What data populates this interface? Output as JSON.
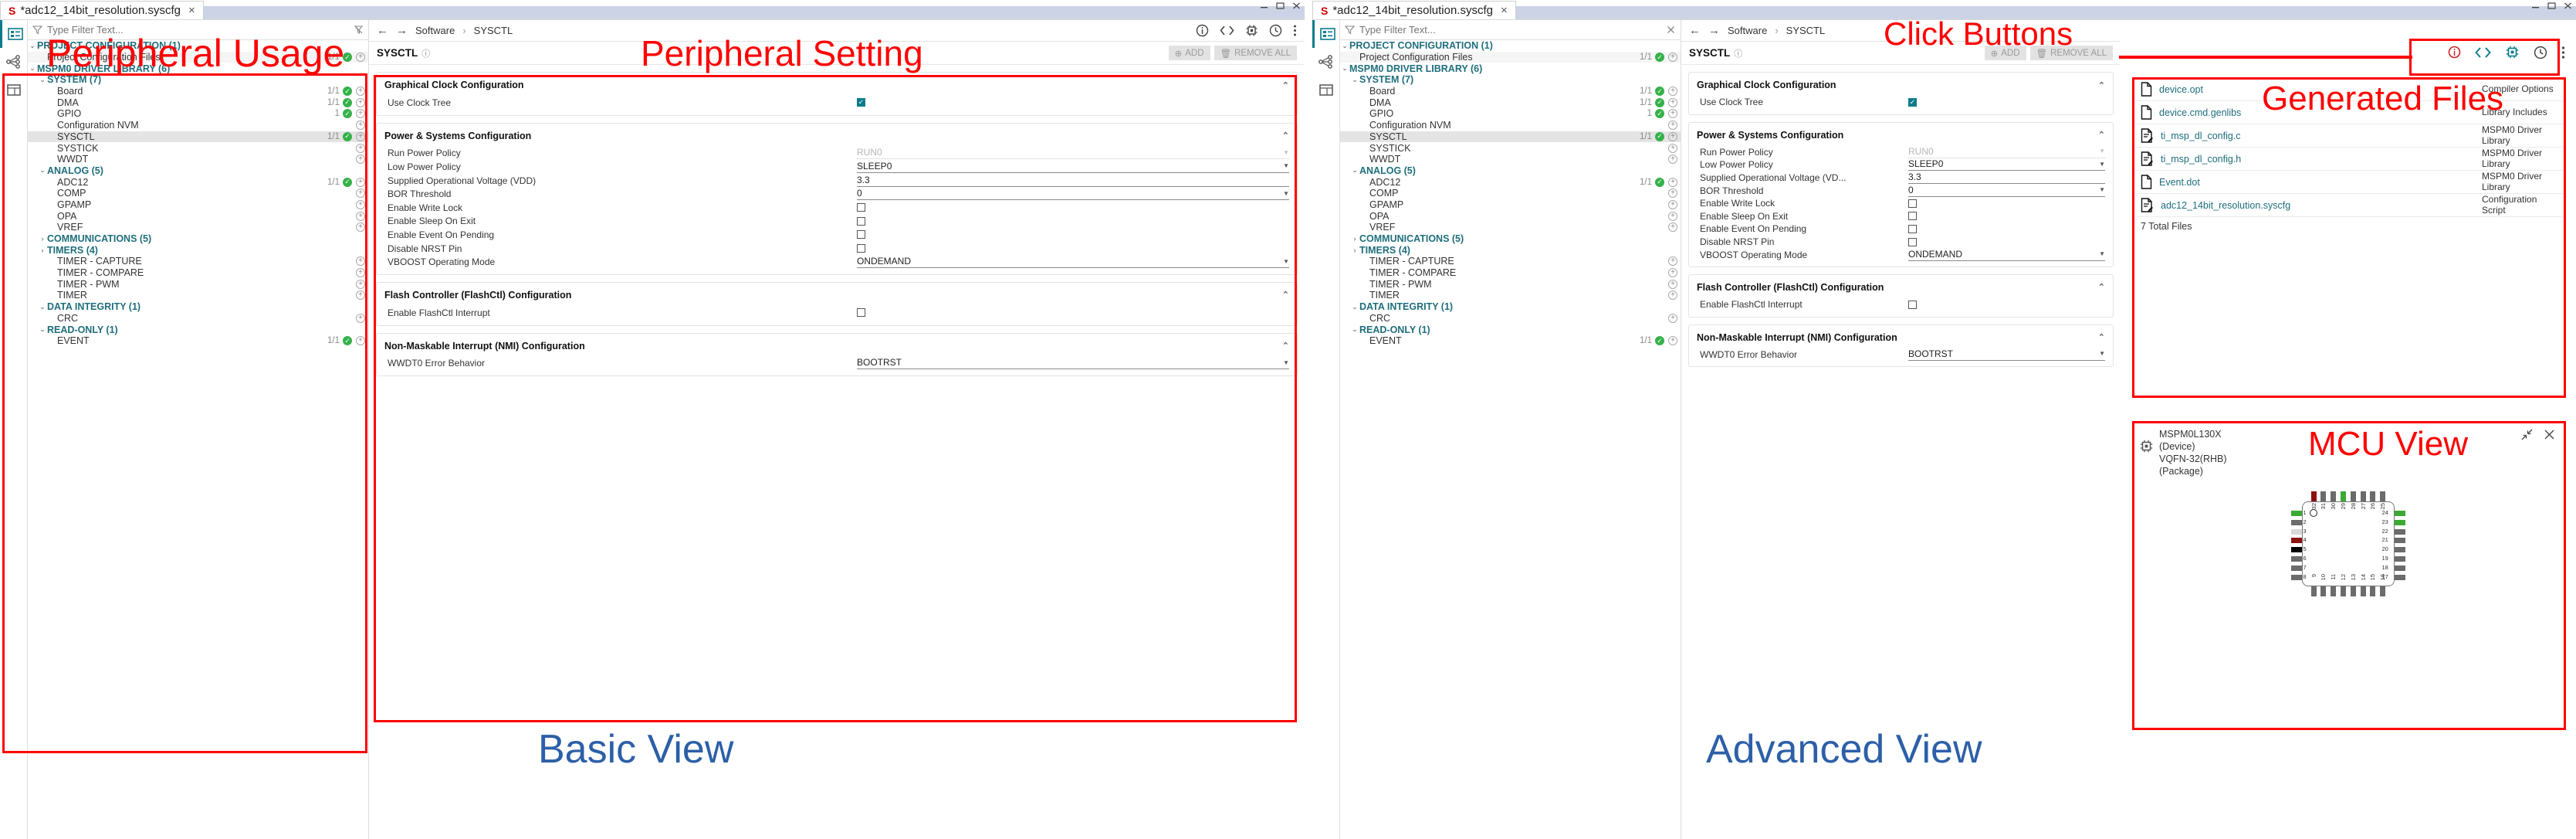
{
  "window_left": {
    "tab": {
      "label": "*adc12_14bit_resolution.syscfg",
      "icon": "syscfg-icon",
      "close": "×"
    },
    "filter": {
      "placeholder": "Type Filter Text...",
      "icon": "filter-icon",
      "clear": "clear-icon"
    },
    "rail": [
      "blocks-icon",
      "network-icon",
      "table-icon"
    ],
    "tree": [
      {
        "label": "PROJECT CONFIGURATION (1)",
        "type": "group",
        "indent": 0,
        "chevron": "⌄",
        "count": "",
        "ok": false,
        "plus": false
      },
      {
        "label": "Project Configuration Files",
        "type": "leaf",
        "indent": 1,
        "count": "1/1",
        "ok": true,
        "plus": true,
        "alt": true
      },
      {
        "label": "MSPM0 DRIVER LIBRARY (6)",
        "type": "group",
        "indent": 0,
        "chevron": "⌄",
        "count": "",
        "ok": false,
        "plus": false
      },
      {
        "label": "SYSTEM (7)",
        "type": "group",
        "indent": 1,
        "chevron": "⌄",
        "count": "",
        "ok": false,
        "plus": false
      },
      {
        "label": "Board",
        "type": "leaf",
        "indent": 2,
        "count": "1/1",
        "ok": true,
        "plus": true
      },
      {
        "label": "DMA",
        "type": "leaf",
        "indent": 2,
        "count": "1/1",
        "ok": true,
        "plus": true
      },
      {
        "label": "GPIO",
        "type": "leaf",
        "indent": 2,
        "count": "1",
        "ok": true,
        "plus": true
      },
      {
        "label": "Configuration NVM",
        "type": "leaf",
        "indent": 2,
        "count": "",
        "ok": false,
        "plus": true
      },
      {
        "label": "SYSCTL",
        "type": "leaf",
        "indent": 2,
        "count": "1/1",
        "ok": true,
        "plus": true,
        "selected": true
      },
      {
        "label": "SYSTICK",
        "type": "leaf",
        "indent": 2,
        "count": "",
        "ok": false,
        "plus": true
      },
      {
        "label": "WWDT",
        "type": "leaf",
        "indent": 2,
        "count": "",
        "ok": false,
        "plus": true
      },
      {
        "label": "ANALOG (5)",
        "type": "group",
        "indent": 1,
        "chevron": "⌄",
        "count": "",
        "ok": false,
        "plus": false
      },
      {
        "label": "ADC12",
        "type": "leaf",
        "indent": 2,
        "count": "1/1",
        "ok": true,
        "plus": true
      },
      {
        "label": "COMP",
        "type": "leaf",
        "indent": 2,
        "count": "",
        "ok": false,
        "plus": true
      },
      {
        "label": "GPAMP",
        "type": "leaf",
        "indent": 2,
        "count": "",
        "ok": false,
        "plus": true
      },
      {
        "label": "OPA",
        "type": "leaf",
        "indent": 2,
        "count": "",
        "ok": false,
        "plus": true
      },
      {
        "label": "VREF",
        "type": "leaf",
        "indent": 2,
        "count": "",
        "ok": false,
        "plus": true
      },
      {
        "label": "COMMUNICATIONS (5)",
        "type": "group",
        "indent": 1,
        "chevron": "›",
        "count": "",
        "ok": false,
        "plus": false
      },
      {
        "label": "TIMERS (4)",
        "type": "group",
        "indent": 1,
        "chevron": "›",
        "count": "",
        "ok": false,
        "plus": false
      },
      {
        "label": "TIMER - CAPTURE",
        "type": "leaf",
        "indent": 2,
        "count": "",
        "ok": false,
        "plus": true
      },
      {
        "label": "TIMER - COMPARE",
        "type": "leaf",
        "indent": 2,
        "count": "",
        "ok": false,
        "plus": true
      },
      {
        "label": "TIMER - PWM",
        "type": "leaf",
        "indent": 2,
        "count": "",
        "ok": false,
        "plus": true
      },
      {
        "label": "TIMER",
        "type": "leaf",
        "indent": 2,
        "count": "",
        "ok": false,
        "plus": true
      },
      {
        "label": "DATA INTEGRITY (1)",
        "type": "group",
        "indent": 1,
        "chevron": "⌄",
        "count": "",
        "ok": false,
        "plus": false
      },
      {
        "label": "CRC",
        "type": "leaf",
        "indent": 2,
        "count": "",
        "ok": false,
        "plus": true
      },
      {
        "label": "READ-ONLY (1)",
        "type": "group",
        "indent": 1,
        "chevron": "⌄",
        "count": "",
        "ok": false,
        "plus": false
      },
      {
        "label": "EVENT",
        "type": "leaf",
        "indent": 2,
        "count": "1/1",
        "ok": true,
        "plus": true
      }
    ],
    "breadcrumb": {
      "back": "←",
      "forward": "→",
      "root": "Software",
      "sep": "›",
      "leaf": "SYSCTL",
      "icons": [
        "info-icon",
        "code-icon",
        "chip-icon",
        "history-icon",
        "more-icon"
      ]
    },
    "module": {
      "name": "SYSCTL",
      "help": "?",
      "add": "ADD",
      "remove": "REMOVE ALL"
    }
  },
  "settings": {
    "sections": [
      {
        "title": "Graphical Clock Configuration",
        "collapse": "⌃",
        "fields": [
          {
            "label": "Use Clock Tree",
            "kind": "checkbox",
            "value": true
          }
        ]
      },
      {
        "title": "Power & Systems Configuration",
        "collapse": "⌃",
        "fields": [
          {
            "label": "Run Power Policy",
            "kind": "select",
            "value": "RUN0",
            "disabled": true
          },
          {
            "label": "Low Power Policy",
            "kind": "select",
            "value": "SLEEP0"
          },
          {
            "label": "Supplied Operational Voltage (VDD)",
            "label_short": "Supplied Operational Voltage (VD...",
            "kind": "text",
            "value": "3.3"
          },
          {
            "label": "BOR Threshold",
            "kind": "select",
            "value": "0"
          },
          {
            "label": "Enable Write Lock",
            "kind": "checkbox",
            "value": false
          },
          {
            "label": "Enable Sleep On Exit",
            "kind": "checkbox",
            "value": false
          },
          {
            "label": "Enable Event On Pending",
            "kind": "checkbox",
            "value": false
          },
          {
            "label": "Disable NRST Pin",
            "kind": "checkbox",
            "value": false
          },
          {
            "label": "VBOOST Operating Mode",
            "kind": "select",
            "value": "ONDEMAND"
          }
        ]
      },
      {
        "title": "Flash Controller (FlashCtl) Configuration",
        "collapse": "⌃",
        "fields": [
          {
            "label": "Enable FlashCtl Interrupt",
            "kind": "checkbox",
            "value": false
          }
        ]
      },
      {
        "title": "Non-Maskable Interrupt (NMI) Configuration",
        "collapse": "⌃",
        "fields": [
          {
            "label": "WWDT0 Error Behavior",
            "kind": "select",
            "value": "BOOTRST"
          }
        ]
      }
    ]
  },
  "generated_files": {
    "rows": [
      {
        "name": "device.opt",
        "kind": "Compiler Options",
        "icon": "file-icon"
      },
      {
        "name": "device.cmd.genlibs",
        "kind": "Library Includes",
        "icon": "file-icon"
      },
      {
        "name": "ti_msp_dl_config.c",
        "kind": "MSPM0 Driver Library",
        "icon": "file-edit-icon"
      },
      {
        "name": "ti_msp_dl_config.h",
        "kind": "MSPM0 Driver Library",
        "icon": "file-edit-icon"
      },
      {
        "name": "Event.dot",
        "kind": "MSPM0 Driver Library",
        "icon": "file-icon"
      },
      {
        "name": "adc12_14bit_resolution.syscfg",
        "kind": "Configuration Script",
        "icon": "file-edit-icon"
      }
    ],
    "total": "7 Total Files"
  },
  "mcu_view": {
    "icon": "chip-icon",
    "device": "MSPM0L130X",
    "device_sub": "(Device)",
    "package": "VQFN-32(RHB)",
    "package_sub": "(Package)",
    "collapse_icon": "collapse-icon",
    "close_icon": "close-icon",
    "pins_left": [
      "1",
      "2",
      "3",
      "4",
      "5",
      "6",
      "7",
      "8"
    ],
    "pins_bottom": [
      "9",
      "10",
      "11",
      "12",
      "13",
      "14",
      "15",
      "16"
    ],
    "pins_right": [
      "24",
      "23",
      "22",
      "21",
      "20",
      "19",
      "18",
      "17"
    ],
    "pins_top": [
      "32",
      "31",
      "30",
      "29",
      "28",
      "27",
      "26",
      "25"
    ],
    "pin_colors_left": [
      "#3aaa35",
      "#6b6b6b",
      "#d8d8d8",
      "#8d1111",
      "#000000",
      "#6b6b6b",
      "#6b6b6b",
      "#6b6b6b"
    ],
    "pin_colors_right": [
      "#3aaa35",
      "#3aaa35",
      "#6b6b6b",
      "#6b6b6b",
      "#6b6b6b",
      "#6b6b6b",
      "#6b6b6b",
      "#6b6b6b"
    ],
    "pin_colors_top": [
      "#8d1111",
      "#6b6b6b",
      "#6b6b6b",
      "#3aaa35",
      "#6b6b6b",
      "#6b6b6b",
      "#6b6b6b",
      "#6b6b6b"
    ],
    "pin_colors_bottom": [
      "#6b6b6b",
      "#6b6b6b",
      "#6b6b6b",
      "#6b6b6b",
      "#6b6b6b",
      "#6b6b6b",
      "#6b6b6b",
      "#6b6b6b"
    ]
  },
  "annotations": {
    "peripheral_usage": "Peripheral Usage",
    "peripheral_setting": "Peripheral Setting",
    "basic_view": "Basic View",
    "advanced_view": "Advanced View",
    "click_buttons": "Click Buttons",
    "generated_files": "Generated Files",
    "mcu_view": "MCU View",
    "color_red": "#ff0000",
    "color_blue": "#2d5fa8"
  }
}
